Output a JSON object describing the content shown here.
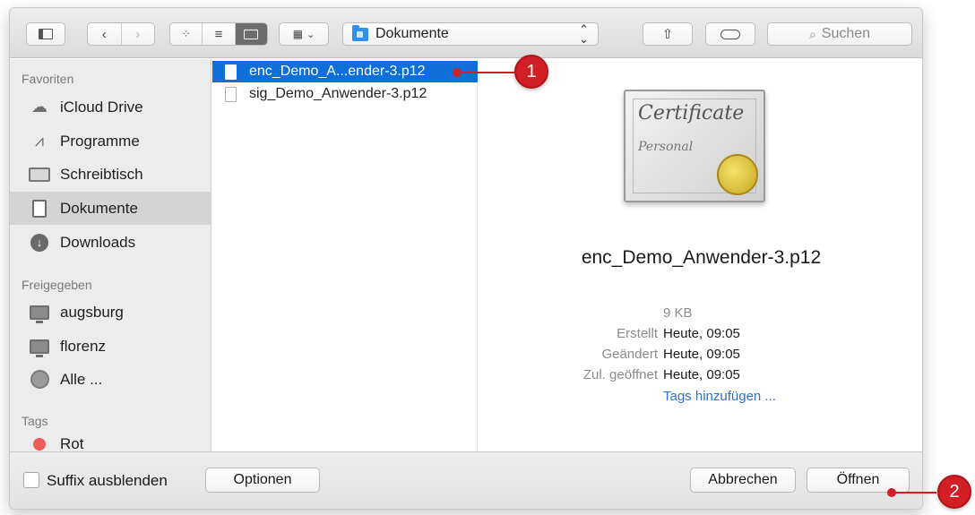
{
  "toolbar": {
    "path_label": "Dokumente",
    "search_placeholder": "Suchen"
  },
  "sidebar": {
    "favorites_header": "Favoriten",
    "shared_header": "Freigegeben",
    "tags_header": "Tags",
    "favorites": [
      {
        "label": "iCloud Drive",
        "icon": "cloud-icon"
      },
      {
        "label": "Programme",
        "icon": "applications-icon"
      },
      {
        "label": "Schreibtisch",
        "icon": "desktop-icon"
      },
      {
        "label": "Dokumente",
        "icon": "documents-icon",
        "selected": true
      },
      {
        "label": "Downloads",
        "icon": "download-icon"
      }
    ],
    "shared": [
      {
        "label": "augsburg",
        "icon": "monitor-icon"
      },
      {
        "label": "florenz",
        "icon": "monitor-icon"
      },
      {
        "label": "Alle ...",
        "icon": "globe-icon"
      }
    ],
    "tags": [
      {
        "label": "Rot",
        "color": "#ee5a55"
      }
    ]
  },
  "files": [
    {
      "name": "enc_Demo_A...ender-3.p12",
      "selected": true
    },
    {
      "name": "sig_Demo_Anwender-3.p12",
      "selected": false
    }
  ],
  "preview": {
    "cert_title": "Certificate",
    "cert_subtitle": "Personal",
    "filename": "enc_Demo_Anwender-3.p12",
    "size": "9 KB",
    "created_label": "Erstellt",
    "created_value": "Heute, 09:05",
    "modified_label": "Geändert",
    "modified_value": "Heute, 09:05",
    "opened_label": "Zul. geöffnet",
    "opened_value": "Heute, 09:05",
    "tags_link": "Tags hinzufügen ..."
  },
  "bottom": {
    "hide_suffix_label": "Suffix ausblenden",
    "options_label": "Optionen",
    "cancel_label": "Abbrechen",
    "open_label": "Öffnen"
  },
  "callouts": {
    "one": "1",
    "two": "2",
    "color": "#d21f26"
  }
}
